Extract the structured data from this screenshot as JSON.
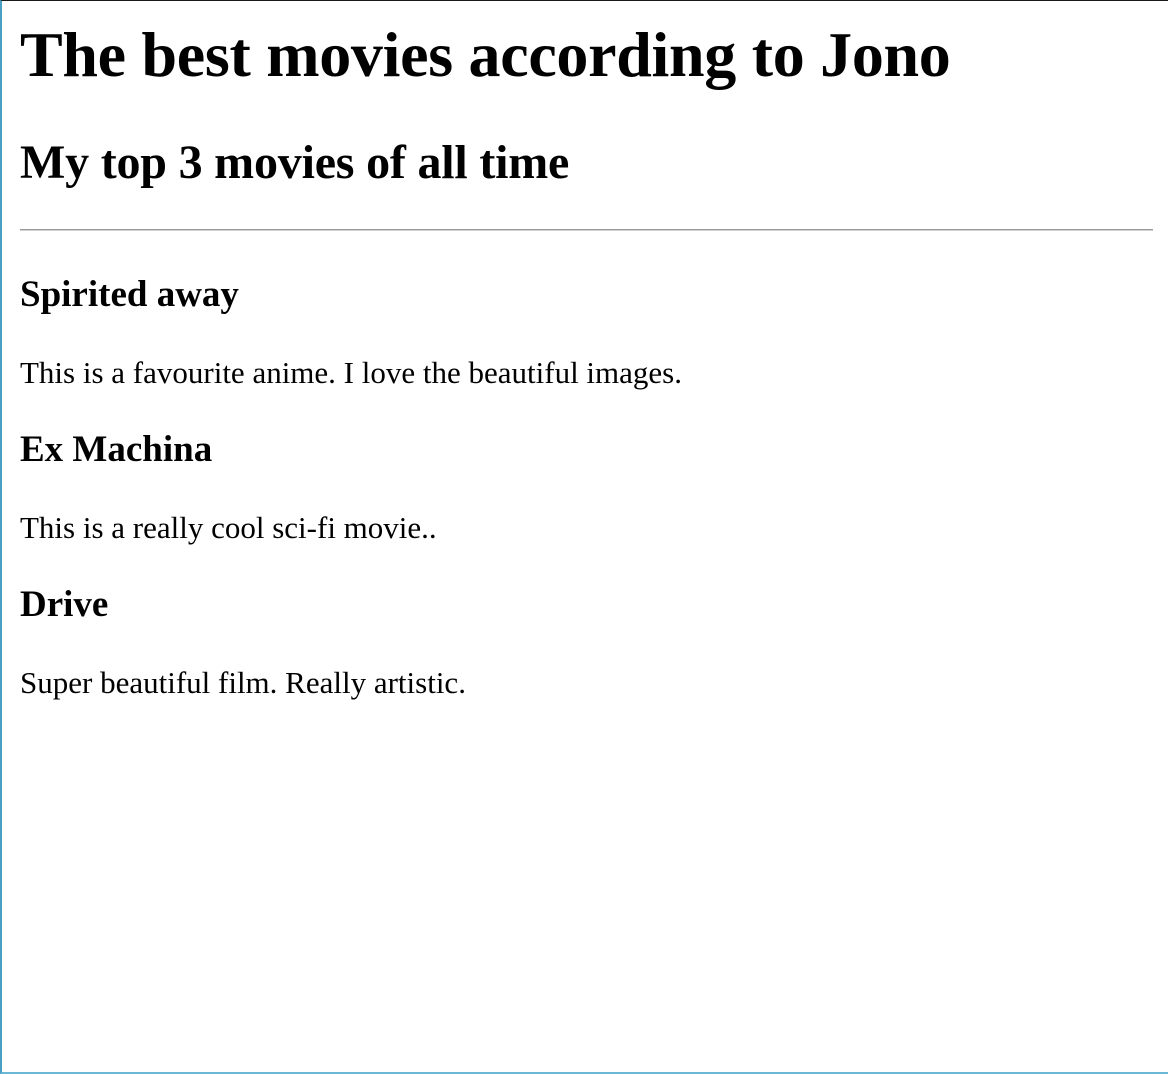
{
  "page": {
    "title": "The best movies according to Jono",
    "subtitle": "My top 3 movies of all time"
  },
  "movies": [
    {
      "title": "Spirited away",
      "description": "This is a favourite anime. I love the beautiful images."
    },
    {
      "title": "Ex Machina",
      "description": "This is a really cool sci-fi movie.."
    },
    {
      "title": "Drive",
      "description": "Super beautiful film. Really artistic."
    }
  ],
  "colors": {
    "text": "#000000",
    "background": "#ffffff",
    "divider": "#9a9a9a",
    "window_edge": "#4a9fc4"
  }
}
